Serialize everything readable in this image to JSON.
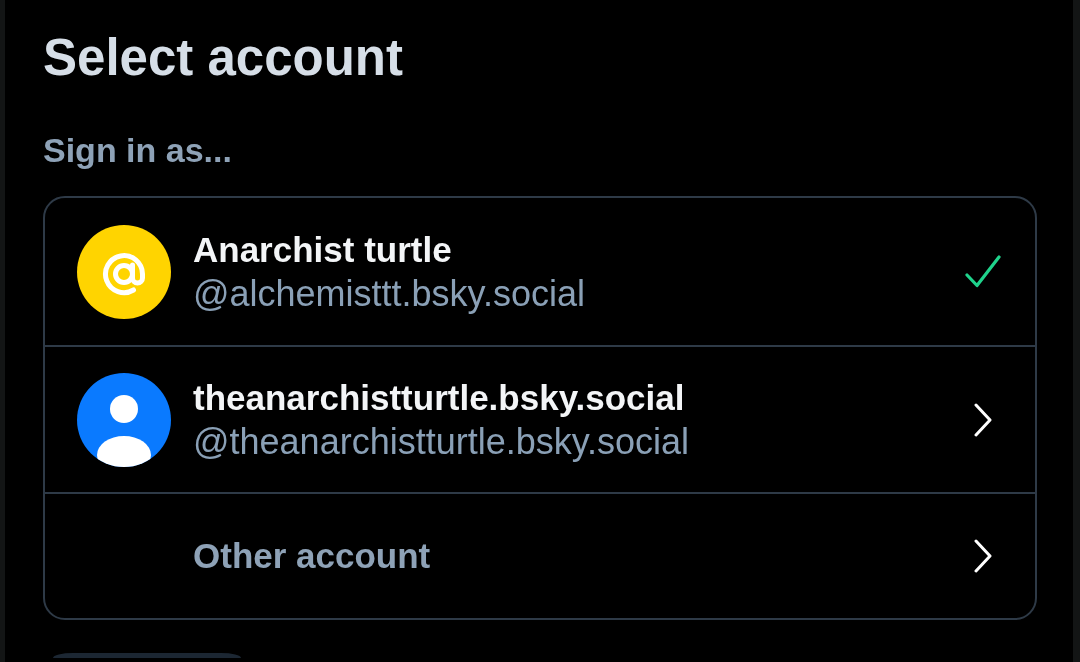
{
  "title": "Select account",
  "subtitle": "Sign in as...",
  "accounts": [
    {
      "kind": "account",
      "avatar": {
        "kind": "at",
        "color": "#ffd400"
      },
      "name": "Anarchist turtle",
      "handle": "@alchemisttt.bsky.social",
      "selected": true
    },
    {
      "kind": "account",
      "avatar": {
        "kind": "person",
        "color": "#0a7aff"
      },
      "name": "theanarchistturtle.bsky.social",
      "handle": "@theanarchistturtle.bsky.social",
      "selected": false
    },
    {
      "kind": "other",
      "label": "Other account",
      "selected": false
    }
  ]
}
